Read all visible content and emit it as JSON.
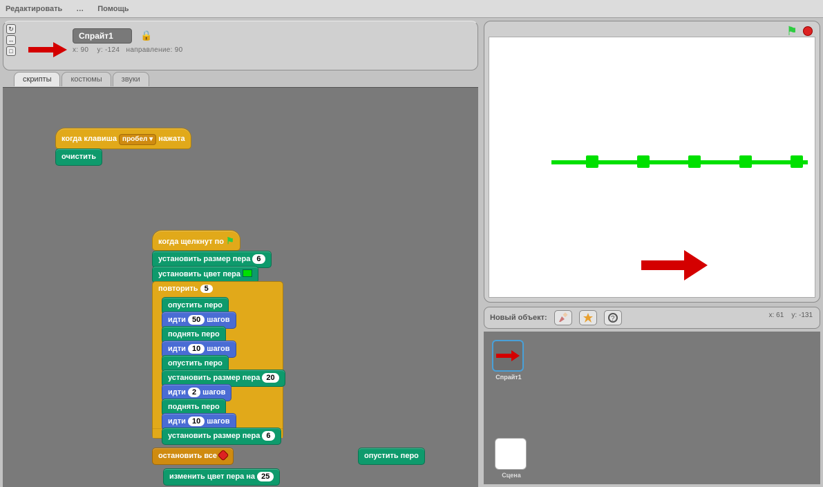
{
  "menubar": [
    "Редактировать",
    "…",
    "Помощь"
  ],
  "sprite": {
    "name": "Спрайт1",
    "x_label": "x:",
    "x": "90",
    "y_label": "y:",
    "y": "-124",
    "dir_label": "направление:",
    "dir": "90"
  },
  "tabs": {
    "scripts": "скрипты",
    "costumes": "костюмы",
    "sounds": "звуки"
  },
  "blocks": {
    "hat_keypress_a": "когда клавиша",
    "hat_keypress_key": "пробел",
    "hat_keypress_b": "нажата",
    "clear": "очистить",
    "hat_greenflag": "когда щелкнут по",
    "set_pen_size_6": "установить размер пера",
    "val_6": "6",
    "set_pen_color": "установить цвет пера",
    "repeat": "повторить",
    "val_5": "5",
    "pen_down": "опустить перо",
    "move_label_a": "идти",
    "move_label_b": "шагов",
    "val_50": "50",
    "pen_up": "поднять перо",
    "val_10": "10",
    "set_pen_size_20": "установить размер пера",
    "val_20": "20",
    "val_2": "2",
    "stop_all": "остановить все",
    "change_pen_color": "изменить цвет пера на",
    "val_25": "25",
    "orphan_pen_down": "опустить перо"
  },
  "stage": {
    "mouse_x_label": "x:",
    "mouse_x": "61",
    "mouse_y_label": "y:",
    "mouse_y": "-131"
  },
  "sprite_list": {
    "new_object": "Новый объект:",
    "thumb1": "Спрайт1",
    "scene": "Сцена"
  }
}
